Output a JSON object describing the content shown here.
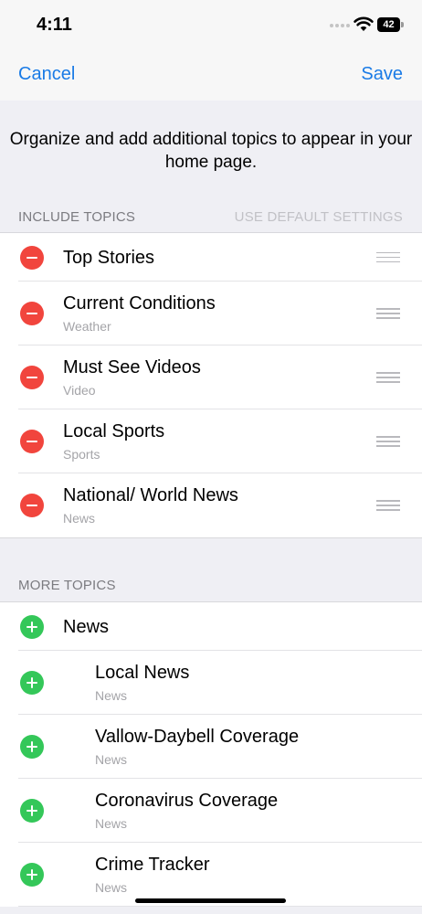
{
  "status_bar": {
    "time": "4:11",
    "battery": "42"
  },
  "nav": {
    "cancel_label": "Cancel",
    "save_label": "Save"
  },
  "intro_text": "Organize and add additional topics to appear in your home page.",
  "include_section": {
    "header": "INCLUDE TOPICS",
    "action": "USE DEFAULT SETTINGS",
    "items": [
      {
        "title": "Top Stories",
        "subtitle": ""
      },
      {
        "title": "Current Conditions",
        "subtitle": "Weather"
      },
      {
        "title": "Must See Videos",
        "subtitle": "Video"
      },
      {
        "title": "Local Sports",
        "subtitle": "Sports"
      },
      {
        "title": "National/ World News",
        "subtitle": "News"
      }
    ]
  },
  "more_section": {
    "header": "MORE TOPICS",
    "items": [
      {
        "title": "News",
        "subtitle": ""
      },
      {
        "title": "Local News",
        "subtitle": "News"
      },
      {
        "title": "Vallow-Daybell Coverage",
        "subtitle": "News"
      },
      {
        "title": "Coronavirus Coverage",
        "subtitle": "News"
      },
      {
        "title": "Crime Tracker",
        "subtitle": "News"
      }
    ]
  },
  "colors": {
    "accent": "#1a7be6",
    "remove": "#f1453d",
    "add": "#34c759"
  },
  "icons": {
    "remove": "minus-circle-icon",
    "add": "plus-circle-icon",
    "reorder": "drag-handle-icon"
  }
}
